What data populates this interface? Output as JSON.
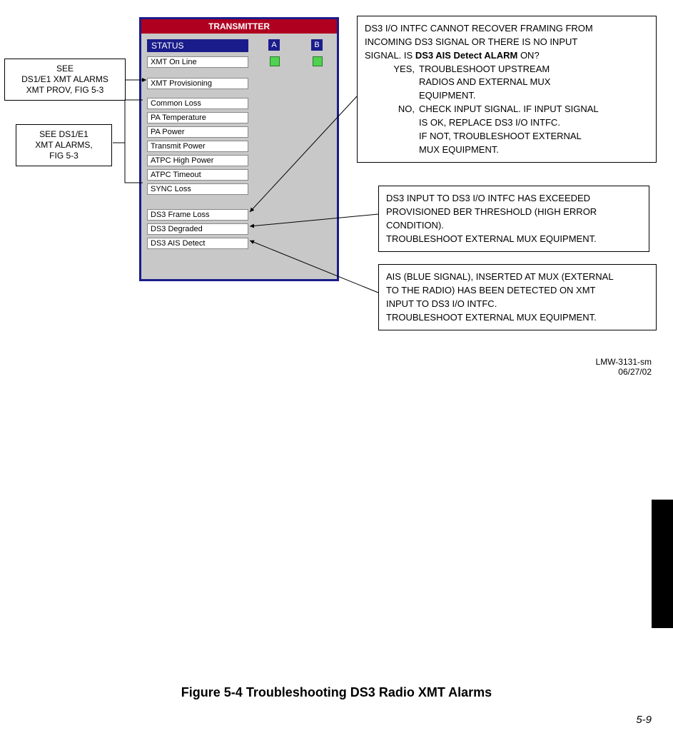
{
  "doc": {
    "id": "LMW-3131-sm",
    "date": "06/27/02",
    "page": "5-9"
  },
  "caption": "Figure 5-4  Troubleshooting DS3 Radio XMT Alarms",
  "notes": {
    "prov": {
      "line1": "SEE",
      "line2": "DS1/E1 XMT ALARMS",
      "line3": "XMT PROV, FIG 5-3"
    },
    "xmt": {
      "line1": "SEE DS1/E1",
      "line2": "XMT ALARMS,",
      "line3": "FIG 5-3"
    }
  },
  "transmitter": {
    "title": "TRANSMITTER",
    "status_label": "STATUS",
    "colA": "A",
    "colB": "B",
    "rows": {
      "online": "XMT On Line",
      "prov": "XMT Provisioning",
      "closs": "Common Loss",
      "patemp": "PA Temperature",
      "papow": "PA Power",
      "txpow": "Transmit Power",
      "atpc_hi": "ATPC High Power",
      "atpc_to": "ATPC Timeout",
      "sync": "SYNC Loss",
      "ds3_fl": "DS3 Frame Loss",
      "ds3_deg": "DS3 Degraded",
      "ds3_ais": "DS3 AIS Detect"
    }
  },
  "trouble": {
    "frame_loss": {
      "l1": "DS3 I/O INTFC CANNOT RECOVER FRAMING FROM",
      "l2": "INCOMING DS3 SIGNAL OR THERE IS NO INPUT",
      "l3a": " SIGNAL. IS ",
      "l3b": "DS3 AIS Detect ALARM",
      "l3c": " ON?",
      "yes_label": "YES,",
      "yes1": "TROUBLESHOOT UPSTREAM",
      "yes2": "RADIOS AND EXTERNAL MUX",
      "yes3": "EQUIPMENT.",
      "no_label": "NO,",
      "no1": "CHECK INPUT SIGNAL. IF INPUT SIGNAL",
      "no2": "IS OK, REPLACE DS3 I/O INTFC.",
      "no3": "IF NOT, TROUBLESHOOT EXTERNAL",
      "no4": "MUX EQUIPMENT."
    },
    "degraded": {
      "l1": "DS3 INPUT TO DS3 I/O INTFC HAS EXCEEDED",
      "l2": "PROVISIONED BER THRESHOLD (HIGH ERROR",
      "l3": "CONDITION).",
      "l4": "TROUBLESHOOT EXTERNAL MUX EQUIPMENT."
    },
    "ais": {
      "l1": "AIS (BLUE SIGNAL), INSERTED AT MUX (EXTERNAL",
      "l2": "TO THE RADIO) HAS BEEN DETECTED ON XMT",
      "l3": "INPUT TO DS3 I/O INTFC.",
      "l4": "TROUBLESHOOT EXTERNAL MUX EQUIPMENT."
    }
  }
}
